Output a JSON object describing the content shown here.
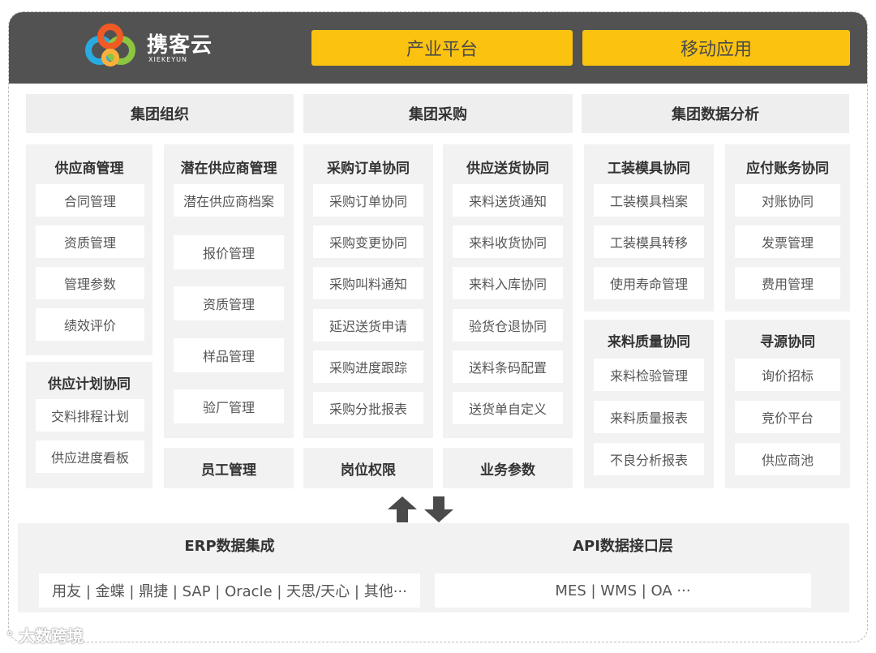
{
  "header": {
    "brand": "携客云",
    "brand_sub": "XIEKEYUN",
    "btn_industry": "产业平台",
    "btn_mobile": "移动应用"
  },
  "sections": {
    "org": "集团组织",
    "purchase": "集团采购",
    "analytics": "集团数据分析"
  },
  "modules": {
    "supplier_mgmt": {
      "title": "供应商管理",
      "items": [
        "合同管理",
        "资质管理",
        "管理参数",
        "绩效评价"
      ]
    },
    "potential_supplier": {
      "title": "潜在供应商管理",
      "items": [
        "潜在供应商档案",
        "报价管理",
        "资质管理",
        "样品管理",
        "验厂管理"
      ]
    },
    "supply_plan": {
      "title": "供应计划协同",
      "items": [
        "交料排程计划",
        "供应进度看板"
      ]
    },
    "po_collab": {
      "title": "采购订单协同",
      "items": [
        "采购订单协同",
        "采购变更协同",
        "采购叫料通知",
        "延迟送货申请",
        "采购进度跟踪",
        "采购分批报表"
      ]
    },
    "delivery_collab": {
      "title": "供应送货协同",
      "items": [
        "来料送货通知",
        "来料收货协同",
        "来料入库协同",
        "验货仓退协同",
        "送料条码配置",
        "送货单自定义"
      ]
    },
    "tooling": {
      "title": "工装模具协同",
      "items": [
        "工装模具档案",
        "工装模具转移",
        "使用寿命管理"
      ]
    },
    "ap": {
      "title": "应付账务协同",
      "items": [
        "对账协同",
        "发票管理",
        "费用管理"
      ]
    },
    "quality": {
      "title": "来料质量协同",
      "items": [
        "来料检验管理",
        "来料质量报表",
        "不良分析报表"
      ]
    },
    "sourcing": {
      "title": "寻源协同",
      "items": [
        "询价招标",
        "竞价平台",
        "供应商池"
      ]
    }
  },
  "footer_items": {
    "staff": "员工管理",
    "position": "岗位权限",
    "params": "业务参数"
  },
  "integration": {
    "erp_title": "ERP数据集成",
    "erp_list": "用友 | 金蝶 | 鼎捷 | SAP | Oracle | 天思/天心 | 其他···",
    "api_title": "API数据接口层",
    "api_list": "MES | WMS | OA ···"
  },
  "watermark": "大数跨境",
  "colors": {
    "accent": "#FBC310",
    "topbar": "#525252",
    "panel": "#f2f2f2"
  }
}
